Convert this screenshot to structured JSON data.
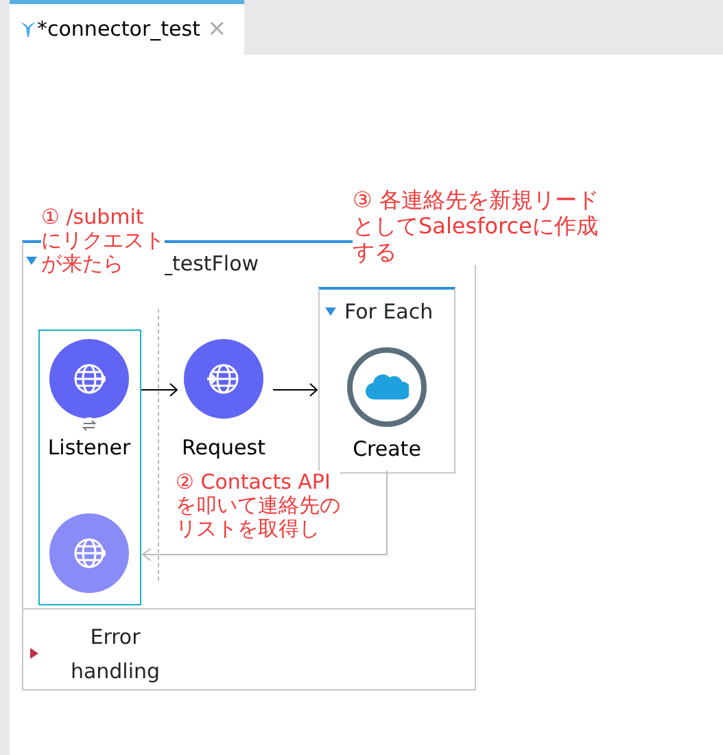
{
  "tab": {
    "title": "*connector_test",
    "close": "×",
    "selected": true
  },
  "flow": {
    "title": "_testFlow",
    "expanded": true,
    "components": [
      {
        "kind": "listener",
        "label": "Listener",
        "selected": true
      },
      {
        "kind": "request",
        "label": "Request"
      },
      {
        "kind": "scope",
        "title": "For Each",
        "expanded": true,
        "children": [
          {
            "kind": "salesforce",
            "label": "Create"
          }
        ]
      },
      {
        "kind": "response"
      }
    ],
    "error_handling": {
      "label": "Error handling",
      "expanded": false
    }
  },
  "annotations": [
    {
      "lines": [
        "① /submit",
        "にリクエスト",
        "が来たら"
      ]
    },
    {
      "lines": [
        "③ 各連絡先を新規リード",
        "としてSalesforceに作成",
        "する"
      ]
    },
    {
      "lines": [
        "② Contacts API",
        "を叩いて連絡先の",
        "リストを取得し"
      ]
    }
  ]
}
